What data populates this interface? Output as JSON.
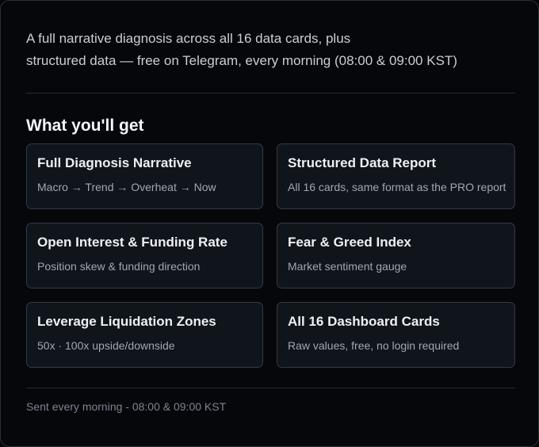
{
  "intro": {
    "line1": "A full narrative diagnosis across all 16 data cards, plus",
    "line2": "structured data — free on Telegram, every morning (08:00 & 09:00 KST)"
  },
  "section": {
    "title": "What you'll get"
  },
  "cards": [
    {
      "title": "Full Diagnosis Narrative",
      "desc": "Macro → Trend → Overheat → Now"
    },
    {
      "title": "Structured Data Report",
      "desc": "All 16 cards, same format as the PRO report"
    },
    {
      "title": "Open Interest & Funding Rate",
      "desc": "Position skew & funding direction"
    },
    {
      "title": "Fear & Greed Index",
      "desc": "Market sentiment gauge"
    },
    {
      "title": "Leverage Liquidation Zones",
      "desc": "50x · 100x upside/downside"
    },
    {
      "title": "All 16 Dashboard Cards",
      "desc": "Raw values, free, no login required"
    }
  ],
  "footer": {
    "text": "Sent every morning - 08:00 & 09:00 KST"
  }
}
